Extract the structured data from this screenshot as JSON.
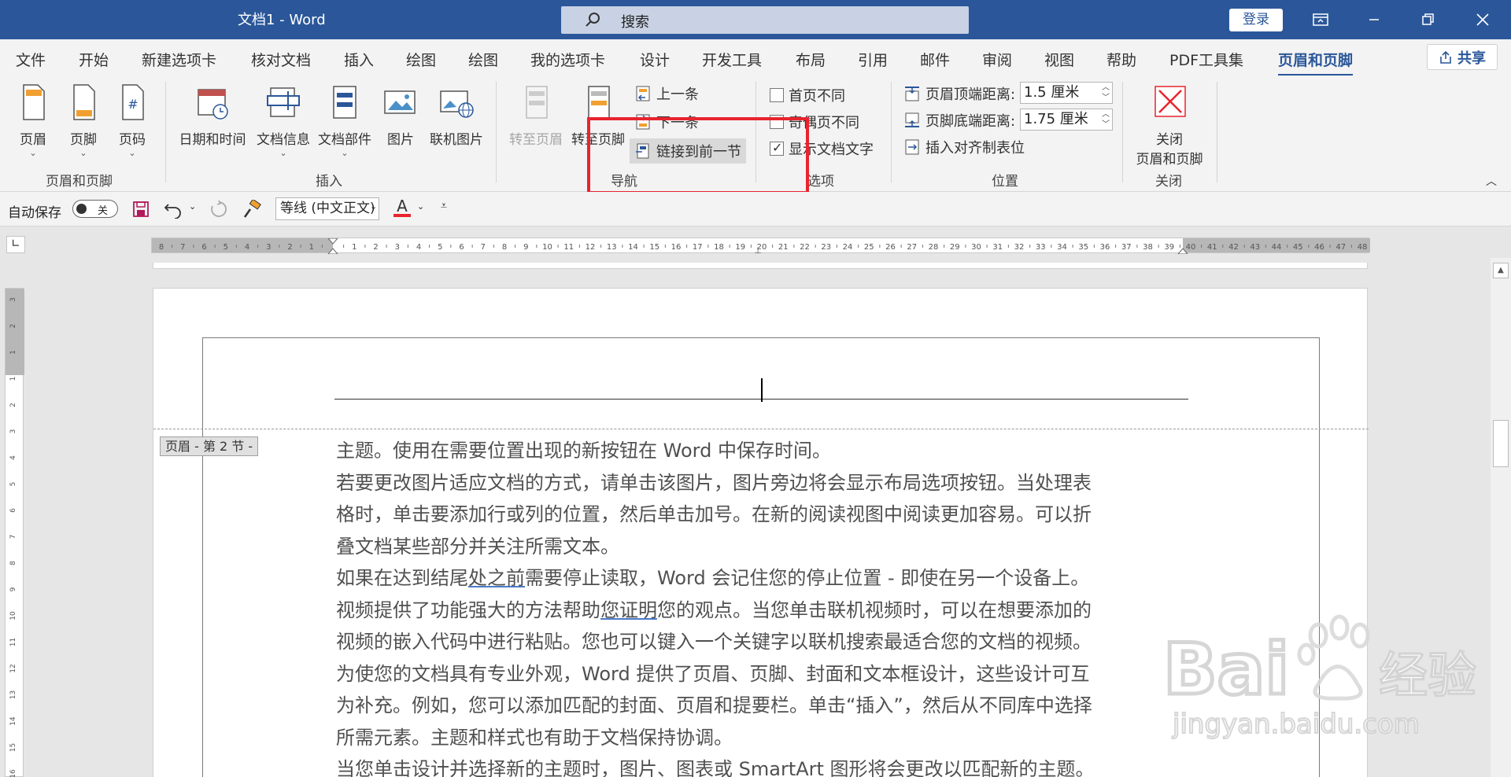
{
  "titlebar": {
    "doc_title": "文档1 - Word",
    "search_placeholder": "搜索",
    "login_label": "登录"
  },
  "tabs": [
    "文件",
    "开始",
    "新建选项卡",
    "核对文档",
    "插入",
    "绘图",
    "绘图",
    "我的选项卡",
    "设计",
    "开发工具",
    "布局",
    "引用",
    "邮件",
    "审阅",
    "视图",
    "帮助",
    "PDF工具集",
    "页眉和页脚"
  ],
  "active_tab": "页眉和页脚",
  "share_label": "共享",
  "ribbon": {
    "group_header_footer": {
      "label": "页眉和页脚",
      "header_label": "页眉",
      "footer_label": "页脚",
      "pagenum_label": "页码"
    },
    "group_insert": {
      "label": "插入",
      "datetime_label": "日期和时间",
      "docinfo_label": "文档信息",
      "docparts_label": "文档部件",
      "picture_label": "图片",
      "online_picture_label": "联机图片"
    },
    "group_nav": {
      "label": "导航",
      "goto_header_label": "转至页眉",
      "goto_footer_label": "转至页脚",
      "previous_label": "上一条",
      "next_label": "下一条",
      "link_prev_label": "链接到前一节"
    },
    "group_options": {
      "label": "选项",
      "first_page_label": "首页不同",
      "odd_even_label": "奇偶页不同",
      "show_text_label": "显示文档文字",
      "show_text_checked": true
    },
    "group_position": {
      "label": "位置",
      "header_top_label": "页眉顶端距离:",
      "header_top_value": "1.5 厘米",
      "footer_bottom_label": "页脚底端距离:",
      "footer_bottom_value": "1.75 厘米",
      "align_tab_label": "插入对齐制表位"
    },
    "group_close": {
      "label": "关闭",
      "close_label_1": "关闭",
      "close_label_2": "页眉和页脚"
    }
  },
  "qat": {
    "autosave_label": "自动保存",
    "autosave_state": "关",
    "font_value": "等线 (中文正文)"
  },
  "ruler": {
    "left_numbers": [
      "8",
      "7",
      "6",
      "5",
      "4",
      "3",
      "2",
      "1"
    ],
    "right_numbers": [
      "1",
      "2",
      "3",
      "4",
      "5",
      "6",
      "7",
      "8",
      "9",
      "10",
      "11",
      "12",
      "13",
      "14",
      "15",
      "16",
      "17",
      "18",
      "19",
      "20",
      "21",
      "22",
      "23",
      "24",
      "25",
      "26",
      "27",
      "28",
      "29",
      "30",
      "31",
      "32",
      "33",
      "34",
      "35",
      "36",
      "37",
      "38",
      "39",
      "40",
      "41",
      "42",
      "43",
      "44",
      "45",
      "46",
      "47",
      "48"
    ],
    "vertical_numbers": [
      "3",
      "2",
      "1",
      "1",
      "2",
      "3",
      "4",
      "5",
      "6",
      "7",
      "8",
      "9",
      "10",
      "11",
      "12",
      "13",
      "14",
      "15",
      "16"
    ]
  },
  "document": {
    "header_tag": "页眉 - 第 2 节 -",
    "lines": [
      [
        "主题。使用在需要位置出现的新按钮在  Word  中保存时间。"
      ],
      [
        "若要更改图片适应文档的方式，请单击该图片，图片旁边将会显示布局选项按钮。当处理表"
      ],
      [
        "格时，单击要添加行或列的位置，然后单击加号。在新的阅读视图中阅读更加容易。可以折"
      ],
      [
        "叠文档某些部分并关注所需文本。"
      ],
      [
        "如果在达到结尾",
        "处之前",
        "需要停止读取，Word  会记住您的停止位置  -  即使在另一个设备上。"
      ],
      [
        "视频提供了功能强大的方法帮助",
        "您证明",
        "您的观点。当您单击联机视频时，可以在想要添加的"
      ],
      [
        "视频的嵌入代码中进行粘贴。您也可以键入一个关键字以联机搜索最适合您的文档的视频。"
      ],
      [
        "为使您的文档具有专业外观，Word  提供了页眉、页脚、封面和文本框设计，这些设计可互"
      ],
      [
        "为补充。例如，您可以添加匹配的封面、页眉和提要栏。单击“插入”，然后从不同库中选择"
      ],
      [
        "所需元素。主题和样式也有助于文档保持协调。"
      ],
      [
        "当您单击设计并选择新的主题时，图片、图表或  SmartArt  图形将会更改以匹配新的主题。"
      ]
    ]
  },
  "watermark": {
    "brand": "Bai",
    "brand_suffix": "经验",
    "url": "jingyan.baidu.com"
  },
  "colors": {
    "titlebar": "#2b579a",
    "highlight_box": "#e8242e",
    "header_icon_orange": "#f0a030",
    "icon_blue": "#2b579a"
  }
}
